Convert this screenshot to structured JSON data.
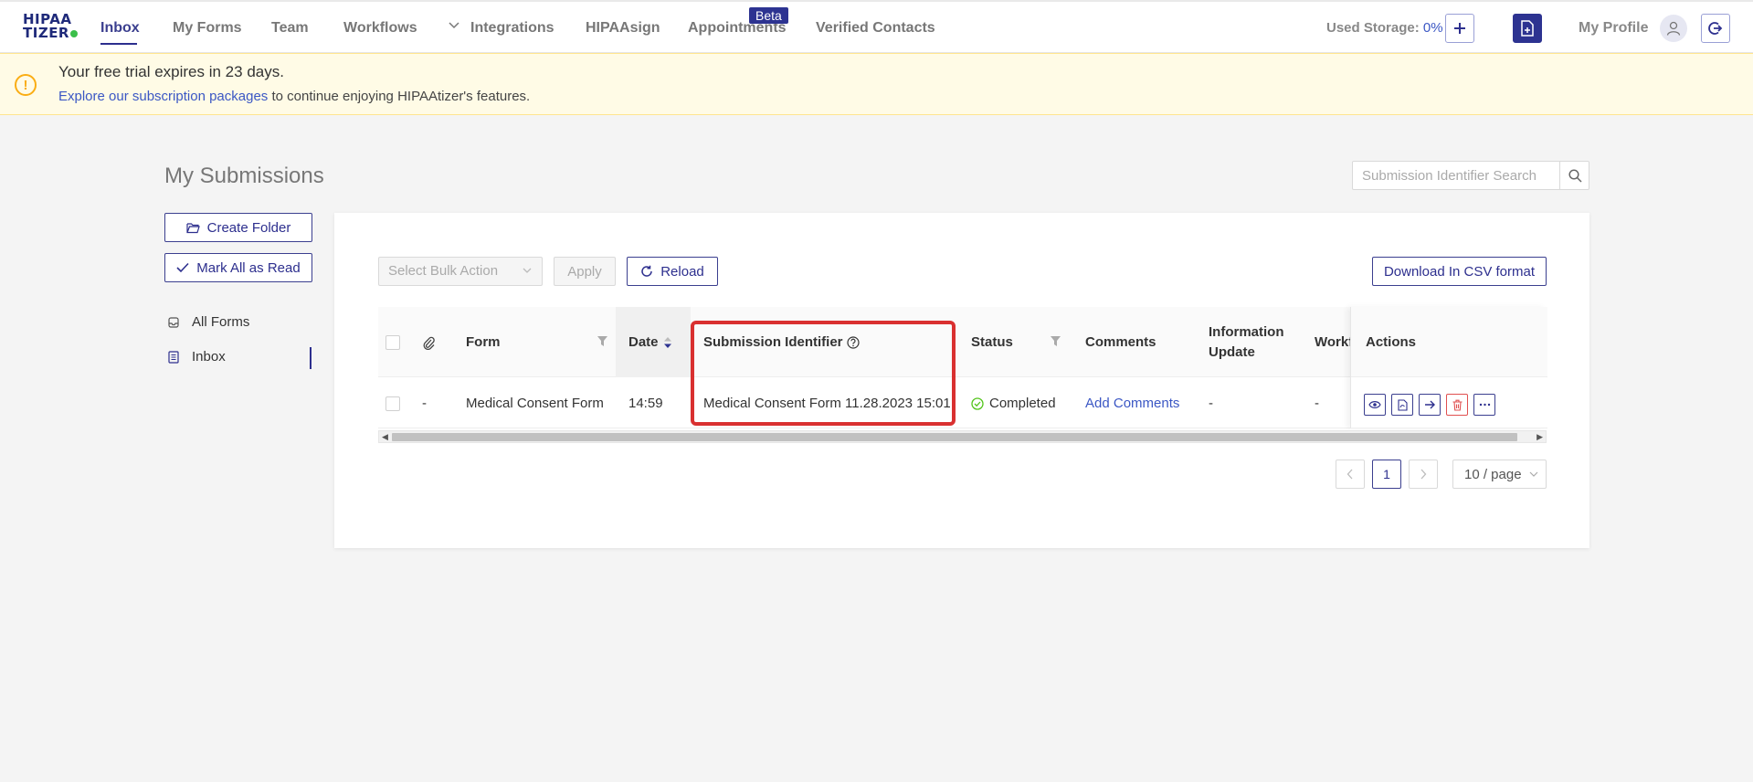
{
  "nav": {
    "logo_line1": "HIPAA",
    "logo_line2": "TIZER",
    "items": [
      "Inbox",
      "My Forms",
      "Team",
      "Workflows",
      "Integrations",
      "HIPAAsign",
      "Appointments",
      "Verified Contacts"
    ],
    "beta_badge": "Beta",
    "used_storage_label": "Used Storage:",
    "used_storage_value": "0%",
    "my_profile": "My Profile"
  },
  "banner": {
    "title": "Your free trial expires in 23 days.",
    "link_text": "Explore our subscription packages",
    "rest_text": "to continue enjoying HIPAAtizer's features."
  },
  "page": {
    "title": "My Submissions",
    "search_placeholder": "Submission Identifier Search"
  },
  "sidebar": {
    "create_folder": "Create Folder",
    "mark_all_read": "Mark All as Read",
    "items": [
      "All Forms",
      "Inbox"
    ]
  },
  "toolbar": {
    "bulk_action_placeholder": "Select Bulk Action",
    "apply": "Apply",
    "reload": "Reload",
    "download_csv": "Download In CSV format"
  },
  "table": {
    "headers": {
      "form": "Form",
      "date": "Date",
      "submission_identifier": "Submission Identifier",
      "status": "Status",
      "comments": "Comments",
      "info_update_1": "Information",
      "info_update_2": "Update",
      "workflow": "Workflow",
      "actions": "Actions"
    },
    "rows": [
      {
        "attachment": "-",
        "form": "Medical Consent Form",
        "date": "14:59",
        "submission_identifier": "Medical Consent Form 11.28.2023 15:01",
        "status": "Completed",
        "comments": "Add Comments",
        "information_update": "-",
        "workflow": "-"
      }
    ]
  },
  "pagination": {
    "current_page": "1",
    "page_size": "10 / page"
  },
  "colors": {
    "primary": "#2d3391",
    "link": "#3b57c4",
    "warning": "#faad14",
    "success": "#52c41a",
    "danger": "#e05050",
    "highlight": "#d93030"
  }
}
